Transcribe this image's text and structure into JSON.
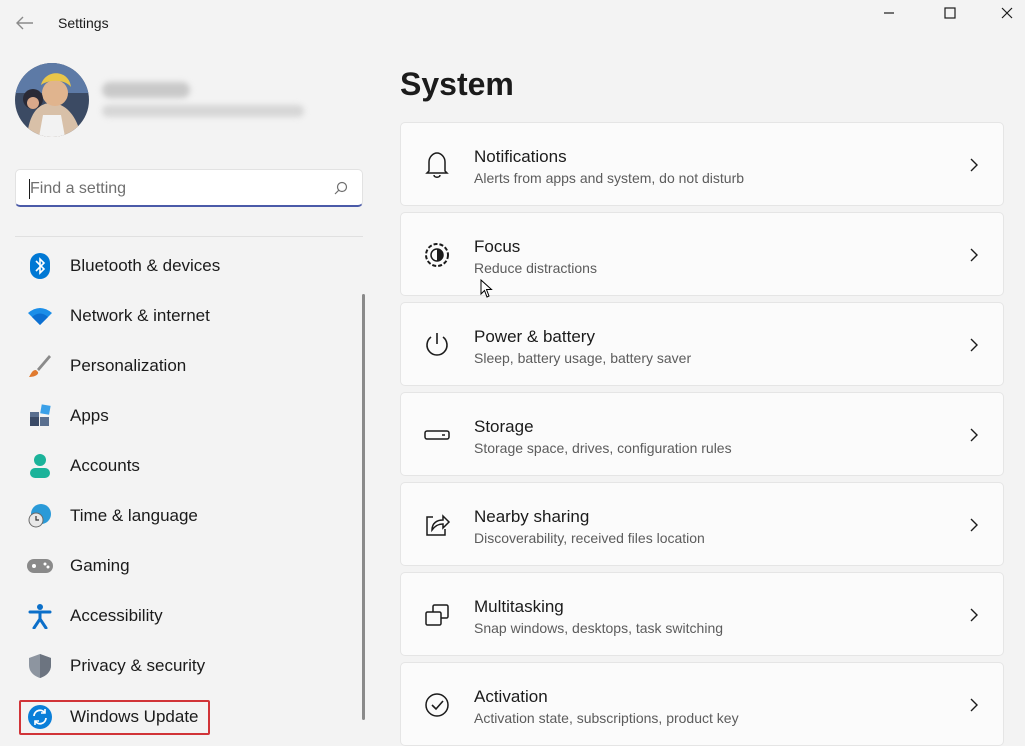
{
  "app": {
    "title": "Settings"
  },
  "search": {
    "placeholder": "Find a setting"
  },
  "sidebar": {
    "items": [
      {
        "label": "Bluetooth & devices",
        "icon": "bluetooth-icon"
      },
      {
        "label": "Network & internet",
        "icon": "wifi-icon"
      },
      {
        "label": "Personalization",
        "icon": "brush-icon"
      },
      {
        "label": "Apps",
        "icon": "apps-icon"
      },
      {
        "label": "Accounts",
        "icon": "person-icon"
      },
      {
        "label": "Time & language",
        "icon": "globe-clock-icon"
      },
      {
        "label": "Gaming",
        "icon": "gamepad-icon"
      },
      {
        "label": "Accessibility",
        "icon": "accessibility-icon"
      },
      {
        "label": "Privacy & security",
        "icon": "shield-icon"
      },
      {
        "label": "Windows Update",
        "icon": "update-icon"
      }
    ]
  },
  "main": {
    "title": "System",
    "cards": [
      {
        "title": "Notifications",
        "desc": "Alerts from apps and system, do not disturb",
        "icon": "bell-icon"
      },
      {
        "title": "Focus",
        "desc": "Reduce distractions",
        "icon": "focus-icon"
      },
      {
        "title": "Power & battery",
        "desc": "Sleep, battery usage, battery saver",
        "icon": "power-icon"
      },
      {
        "title": "Storage",
        "desc": "Storage space, drives, configuration rules",
        "icon": "storage-icon"
      },
      {
        "title": "Nearby sharing",
        "desc": "Discoverability, received files location",
        "icon": "share-icon"
      },
      {
        "title": "Multitasking",
        "desc": "Snap windows, desktops, task switching",
        "icon": "multitask-icon"
      },
      {
        "title": "Activation",
        "desc": "Activation state, subscriptions, product key",
        "icon": "check-circle-icon"
      }
    ]
  },
  "colors": {
    "accent": "#4a5aa8",
    "highlight": "#d13438",
    "background": "#f3f3f3"
  }
}
